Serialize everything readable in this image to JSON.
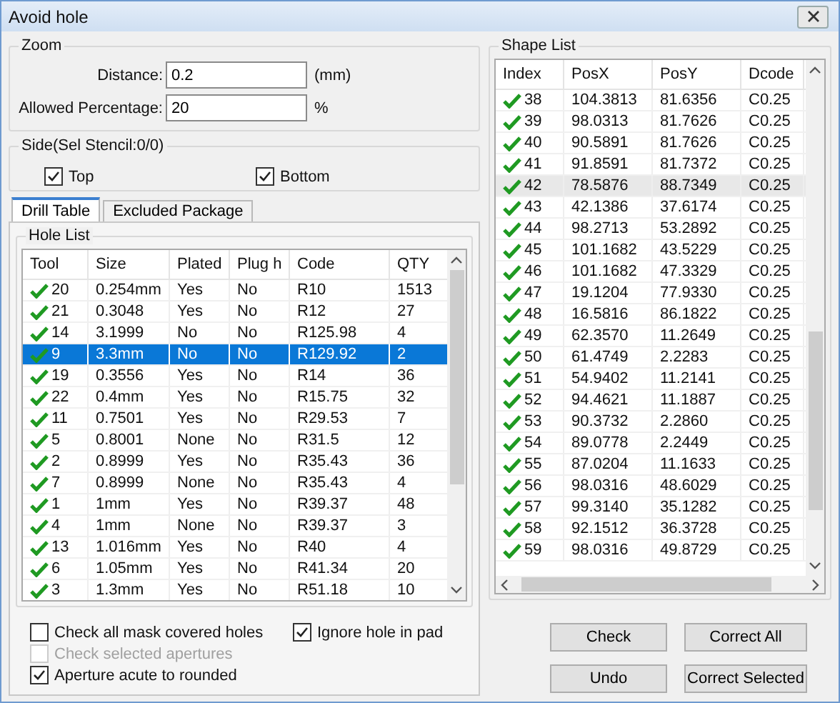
{
  "window": {
    "title": "Avoid hole"
  },
  "zoom": {
    "title": "Zoom",
    "fields": [
      {
        "label": "Distance:",
        "value": "0.2",
        "unit": "(mm)"
      },
      {
        "label": "Allowed Percentage:",
        "value": "20",
        "unit": "%"
      }
    ]
  },
  "side": {
    "title": "Side(Sel Stencil:0/0)",
    "options": [
      {
        "label": "Top",
        "checked": true
      },
      {
        "label": "Bottom",
        "checked": true
      }
    ]
  },
  "tabs": [
    {
      "label": "Drill Table",
      "selected": true
    },
    {
      "label": "Excluded Package",
      "selected": false
    }
  ],
  "hole_list": {
    "title": "Hole List",
    "columns": [
      "Tool",
      "Size",
      "Plated",
      "Plug h",
      "Code",
      "QTY"
    ],
    "rows": [
      {
        "checked": true,
        "selected": false,
        "cells": [
          "20",
          "0.254mm",
          "Yes",
          "No",
          "R10",
          "1513"
        ]
      },
      {
        "checked": true,
        "selected": false,
        "cells": [
          "21",
          "0.3048",
          "Yes",
          "No",
          "R12",
          "27"
        ]
      },
      {
        "checked": true,
        "selected": false,
        "cells": [
          "14",
          "3.1999",
          "No",
          "No",
          "R125.98",
          "4"
        ]
      },
      {
        "checked": true,
        "selected": true,
        "cells": [
          "9",
          "3.3mm",
          "No",
          "No",
          "R129.92",
          "2"
        ]
      },
      {
        "checked": true,
        "selected": false,
        "cells": [
          "19",
          "0.3556",
          "Yes",
          "No",
          "R14",
          "36"
        ]
      },
      {
        "checked": true,
        "selected": false,
        "cells": [
          "22",
          "0.4mm",
          "Yes",
          "No",
          "R15.75",
          "32"
        ]
      },
      {
        "checked": true,
        "selected": false,
        "cells": [
          "11",
          "0.7501",
          "Yes",
          "No",
          "R29.53",
          "7"
        ]
      },
      {
        "checked": true,
        "selected": false,
        "cells": [
          "5",
          "0.8001",
          "None",
          "No",
          "R31.5",
          "12"
        ]
      },
      {
        "checked": true,
        "selected": false,
        "cells": [
          "2",
          "0.8999",
          "Yes",
          "No",
          "R35.43",
          "36"
        ]
      },
      {
        "checked": true,
        "selected": false,
        "cells": [
          "7",
          "0.8999",
          "None",
          "No",
          "R35.43",
          "4"
        ]
      },
      {
        "checked": true,
        "selected": false,
        "cells": [
          "1",
          "1mm",
          "Yes",
          "No",
          "R39.37",
          "48"
        ]
      },
      {
        "checked": true,
        "selected": false,
        "cells": [
          "4",
          "1mm",
          "None",
          "No",
          "R39.37",
          "3"
        ]
      },
      {
        "checked": true,
        "selected": false,
        "cells": [
          "13",
          "1.016mm",
          "Yes",
          "No",
          "R40",
          "4"
        ]
      },
      {
        "checked": true,
        "selected": false,
        "cells": [
          "6",
          "1.05mm",
          "Yes",
          "No",
          "R41.34",
          "20"
        ]
      },
      {
        "checked": true,
        "selected": false,
        "cells": [
          "3",
          "1.3mm",
          "Yes",
          "No",
          "R51.18",
          "10"
        ]
      }
    ]
  },
  "options": [
    {
      "label": "Check all mask covered holes",
      "checked": false,
      "disabled": false
    },
    {
      "label": "Ignore hole in pad",
      "checked": true,
      "disabled": false
    },
    {
      "label": "Check selected apertures",
      "checked": false,
      "disabled": true
    },
    {
      "label": "Aperture acute to rounded",
      "checked": true,
      "disabled": false
    }
  ],
  "shape_list": {
    "title": "Shape List",
    "columns": [
      "Index",
      "PosX",
      "PosY",
      "Dcode"
    ],
    "rows": [
      {
        "checked": true,
        "selected": false,
        "cells": [
          "38",
          "104.3813",
          "81.6356",
          "C0.25"
        ]
      },
      {
        "checked": true,
        "selected": false,
        "cells": [
          "39",
          "98.0313",
          "81.7626",
          "C0.25"
        ]
      },
      {
        "checked": true,
        "selected": false,
        "cells": [
          "40",
          "90.5891",
          "81.7626",
          "C0.25"
        ]
      },
      {
        "checked": true,
        "selected": false,
        "cells": [
          "41",
          "91.8591",
          "81.7372",
          "C0.25"
        ]
      },
      {
        "checked": true,
        "selected": true,
        "cells": [
          "42",
          "78.5876",
          "88.7349",
          "C0.25"
        ]
      },
      {
        "checked": true,
        "selected": false,
        "cells": [
          "43",
          "42.1386",
          "37.6174",
          "C0.25"
        ]
      },
      {
        "checked": true,
        "selected": false,
        "cells": [
          "44",
          "98.2713",
          "53.2892",
          "C0.25"
        ]
      },
      {
        "checked": true,
        "selected": false,
        "cells": [
          "45",
          "101.1682",
          "43.5229",
          "C0.25"
        ]
      },
      {
        "checked": true,
        "selected": false,
        "cells": [
          "46",
          "101.1682",
          "47.3329",
          "C0.25"
        ]
      },
      {
        "checked": true,
        "selected": false,
        "cells": [
          "47",
          "19.1204",
          "77.9330",
          "C0.25"
        ]
      },
      {
        "checked": true,
        "selected": false,
        "cells": [
          "48",
          "16.5816",
          "86.1822",
          "C0.25"
        ]
      },
      {
        "checked": true,
        "selected": false,
        "cells": [
          "49",
          "62.3570",
          "11.2649",
          "C0.25"
        ]
      },
      {
        "checked": true,
        "selected": false,
        "cells": [
          "50",
          "61.4749",
          "2.2283",
          "C0.25"
        ]
      },
      {
        "checked": true,
        "selected": false,
        "cells": [
          "51",
          "54.9402",
          "11.2141",
          "C0.25"
        ]
      },
      {
        "checked": true,
        "selected": false,
        "cells": [
          "52",
          "94.4621",
          "11.1887",
          "C0.25"
        ]
      },
      {
        "checked": true,
        "selected": false,
        "cells": [
          "53",
          "90.3732",
          "2.2860",
          "C0.25"
        ]
      },
      {
        "checked": true,
        "selected": false,
        "cells": [
          "54",
          "89.0778",
          "2.2449",
          "C0.25"
        ]
      },
      {
        "checked": true,
        "selected": false,
        "cells": [
          "55",
          "87.0204",
          "11.1633",
          "C0.25"
        ]
      },
      {
        "checked": true,
        "selected": false,
        "cells": [
          "56",
          "98.0316",
          "48.6029",
          "C0.25"
        ]
      },
      {
        "checked": true,
        "selected": false,
        "cells": [
          "57",
          "99.3140",
          "35.1282",
          "C0.25"
        ]
      },
      {
        "checked": true,
        "selected": false,
        "cells": [
          "58",
          "92.1512",
          "36.3728",
          "C0.25"
        ]
      },
      {
        "checked": true,
        "selected": false,
        "cells": [
          "59",
          "98.0316",
          "49.8729",
          "C0.25"
        ]
      }
    ]
  },
  "buttons": [
    "Check",
    "Correct All",
    "Undo",
    "Correct Selected"
  ]
}
